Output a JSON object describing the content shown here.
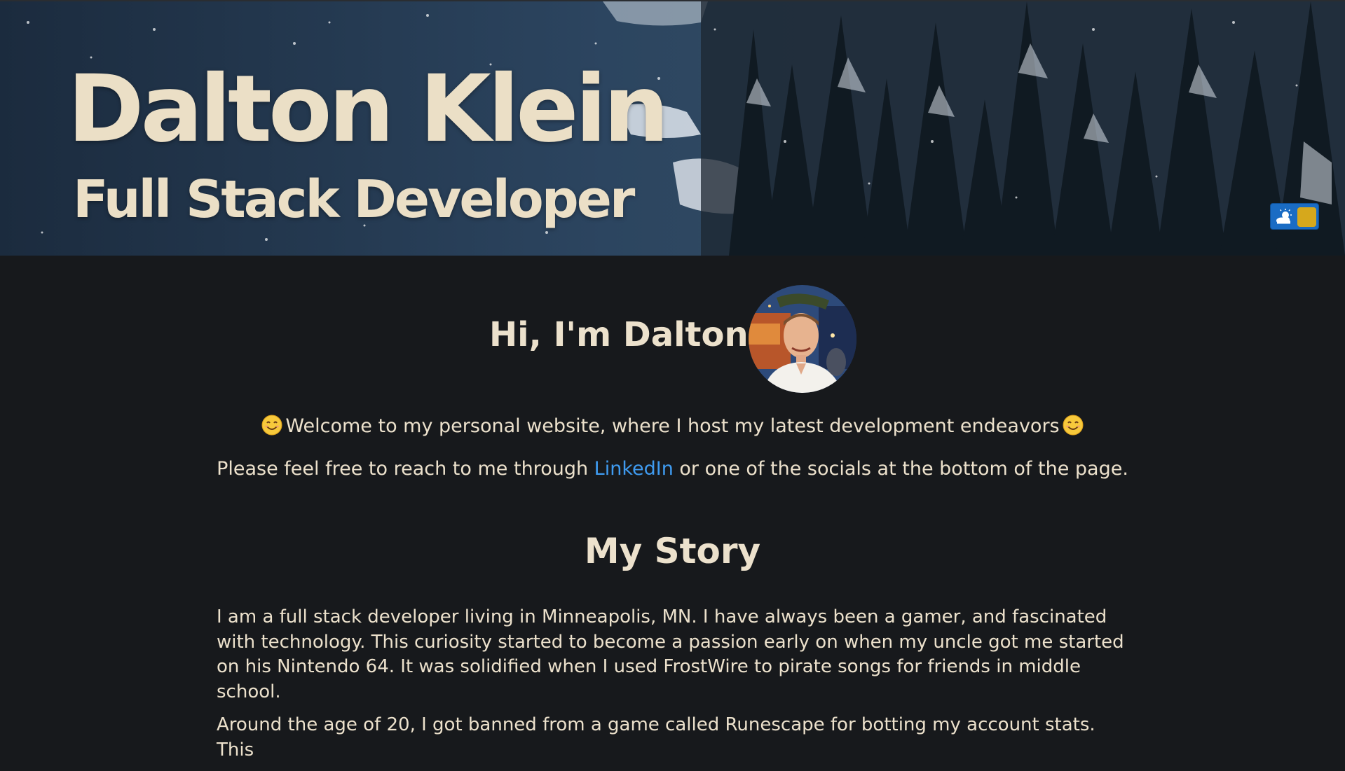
{
  "hero": {
    "title": "Dalton Klein",
    "subtitle": "Full Stack Developer",
    "theme_toggle": {
      "icon": "sun-cloud-icon",
      "toggle_color": "#1a6cc4",
      "knob_color": "#d6a81c"
    }
  },
  "intro": {
    "heading": "Hi, I'm Dalton",
    "avatar_icon": "profile-photo",
    "welcome_text": "Welcome to my personal website, where I host my latest development endeavors",
    "welcome_emoji": "smiling-face-icon",
    "reach_before": "Please feel free to reach to me through ",
    "reach_link": "LinkedIn",
    "reach_after": " or one of the socials at the bottom of the page."
  },
  "story": {
    "heading": "My Story",
    "paragraphs": [
      "I am a full stack developer living in Minneapolis, MN. I have always been a gamer, and fascinated with technology. This curiosity started to become a passion early on when my uncle got me started on his Nintendo 64. It was solidified when I used FrostWire to pirate songs for friends in middle school.",
      "Around the age of 20, I got banned from a game called Runescape for botting my account stats. This"
    ]
  },
  "colors": {
    "background": "#17191c",
    "text": "#ece1cc",
    "link": "#3f9bf0"
  }
}
